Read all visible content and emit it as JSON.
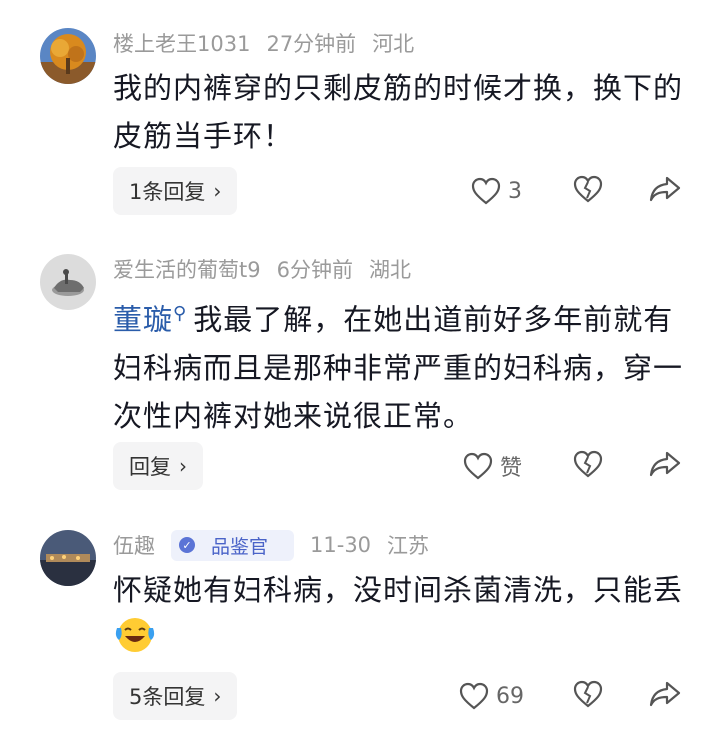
{
  "comments": [
    {
      "user": "楼上老王1031",
      "time": "27分钟前",
      "location": "河北",
      "text": "我的内裤穿的只剩皮筋的时候才换，换下的皮筋当手环！",
      "reply_label": "1条回复",
      "like_count": "3"
    },
    {
      "user": "爱生活的葡萄t9",
      "time": "6分钟前",
      "location": "湖北",
      "mention": "董璇",
      "text": "我最了解，在她出道前好多年前就有妇科病而且是那种非常严重的妇科病，穿一次性内裤对她来说很正常。",
      "reply_label": "回复",
      "like_count": "赞"
    },
    {
      "user": "伍趣",
      "badge": "品鉴官",
      "time": "11-30",
      "location": "江苏",
      "text": "怀疑她有妇科病，没时间杀菌清洗，只能丢",
      "reply_label": "5条回复",
      "like_count": "69"
    }
  ],
  "icons": {
    "like": "heart-outline-icon",
    "dislike": "broken-heart-icon",
    "share": "share-arrow-icon",
    "chevron": "chevron-right-icon",
    "mention": "search-mention-icon",
    "badge": "verified-check-icon",
    "emoji": "crying-laughing-emoji"
  }
}
